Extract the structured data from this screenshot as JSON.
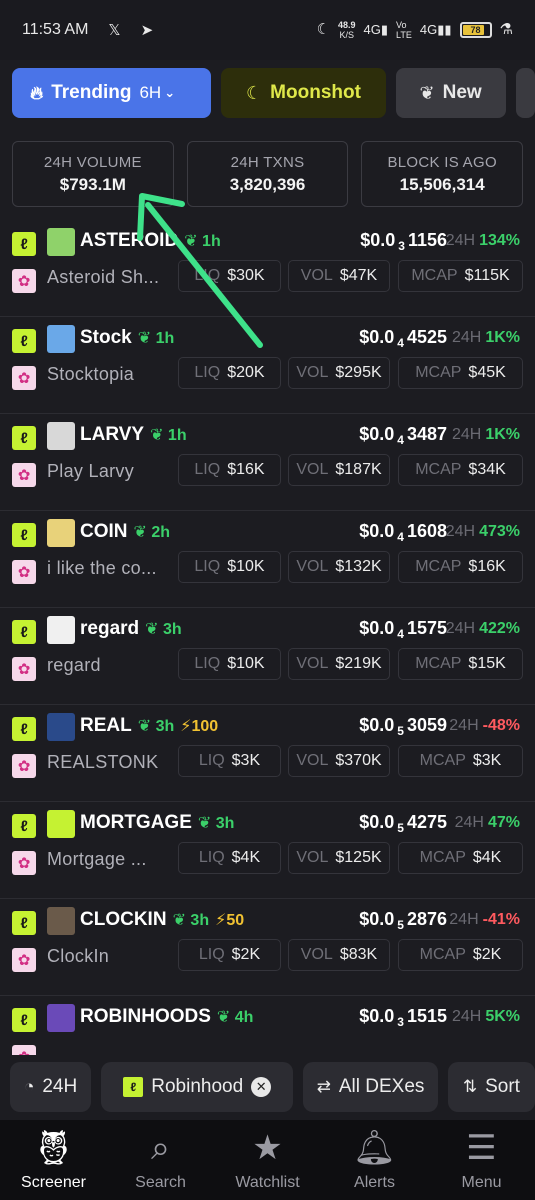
{
  "status_bar": {
    "time": "11:53 AM",
    "apps": "𝕏 ➤",
    "net_speed": "48.9",
    "net_unit": "K/S",
    "battery": "78"
  },
  "tabs": {
    "trending": "Trending",
    "trending_period": "6H",
    "moonshot": "Moonshot",
    "new": "New"
  },
  "stats": {
    "volume_label": "24H VOLUME",
    "volume_value": "$793.1M",
    "txns_label": "24H TXNS",
    "txns_value": "3,820,396",
    "block_label": "BLOCK IS AGO",
    "block_value": "15,506,314"
  },
  "pill_labels": {
    "liq": "LIQ",
    "vol": "VOL",
    "mcap": "MCAP",
    "change": "24H"
  },
  "tokens": [
    {
      "symbol": "ASTEROID",
      "age": "1h",
      "boost": "",
      "name": "Asteroid Sh...",
      "price_prefix": "$0.0",
      "price_zeros": "3",
      "price_digits": "1156",
      "change": "134%",
      "liq": "$30K",
      "vol": "$47K",
      "mcap": "$115K",
      "avatar_color": "#8fd26a"
    },
    {
      "symbol": "Stock",
      "age": "1h",
      "boost": "",
      "name": "Stocktopia",
      "price_prefix": "$0.0",
      "price_zeros": "4",
      "price_digits": "4525",
      "change": "1K%",
      "liq": "$20K",
      "vol": "$295K",
      "mcap": "$45K",
      "avatar_color": "#6aa8e8"
    },
    {
      "symbol": "LARVY",
      "age": "1h",
      "boost": "",
      "name": "Play Larvy",
      "price_prefix": "$0.0",
      "price_zeros": "4",
      "price_digits": "3487",
      "change": "1K%",
      "liq": "$16K",
      "vol": "$187K",
      "mcap": "$34K",
      "avatar_color": "#d8d8d8"
    },
    {
      "symbol": "COIN",
      "age": "2h",
      "boost": "",
      "name": "i like the co...",
      "price_prefix": "$0.0",
      "price_zeros": "4",
      "price_digits": "1608",
      "change": "473%",
      "liq": "$10K",
      "vol": "$132K",
      "mcap": "$16K",
      "avatar_color": "#e8d27a"
    },
    {
      "symbol": "regard",
      "age": "3h",
      "boost": "",
      "name": "regard",
      "price_prefix": "$0.0",
      "price_zeros": "4",
      "price_digits": "1575",
      "change": "422%",
      "liq": "$10K",
      "vol": "$219K",
      "mcap": "$15K",
      "avatar_color": "#f0f0f0"
    },
    {
      "symbol": "REAL",
      "age": "3h",
      "boost": "⚡100",
      "name": "REALSTONK",
      "price_prefix": "$0.0",
      "price_zeros": "5",
      "price_digits": "3059",
      "change": "-48%",
      "liq": "$3K",
      "vol": "$370K",
      "mcap": "$3K",
      "avatar_color": "#2a4a8a"
    },
    {
      "symbol": "MORTGAGE",
      "age": "3h",
      "boost": "",
      "name": "Mortgage ...",
      "price_prefix": "$0.0",
      "price_zeros": "5",
      "price_digits": "4275",
      "change": "47%",
      "liq": "$4K",
      "vol": "$125K",
      "mcap": "$4K",
      "avatar_color": "#c5f232"
    },
    {
      "symbol": "CLOCKIN",
      "age": "3h",
      "boost": "⚡50",
      "name": "ClockIn",
      "price_prefix": "$0.0",
      "price_zeros": "5",
      "price_digits": "2876",
      "change": "-41%",
      "liq": "$2K",
      "vol": "$83K",
      "mcap": "$2K",
      "avatar_color": "#6a5a4a"
    },
    {
      "symbol": "ROBINHOODS",
      "age": "4h",
      "boost": "",
      "name": "",
      "price_prefix": "$0.0",
      "price_zeros": "3",
      "price_digits": "1515",
      "change": "5K%",
      "liq": "",
      "vol": "",
      "mcap": "",
      "avatar_color": "#6a4ab8"
    }
  ],
  "filters": {
    "period": "24H",
    "chain": "Robinhood",
    "dex": "All DEXes",
    "sort": "Sort"
  },
  "nav": {
    "screener": "Screener",
    "search": "Search",
    "watchlist": "Watchlist",
    "alerts": "Alerts",
    "menu": "Menu"
  },
  "colors": {
    "accent_blue": "#4a74e8",
    "moonshot_yellow": "#dfe84a",
    "positive": "#3bd06a",
    "negative": "#ff5a5f",
    "chain_lime": "#c5f232",
    "annotation_arrow": "#3ee28a"
  }
}
